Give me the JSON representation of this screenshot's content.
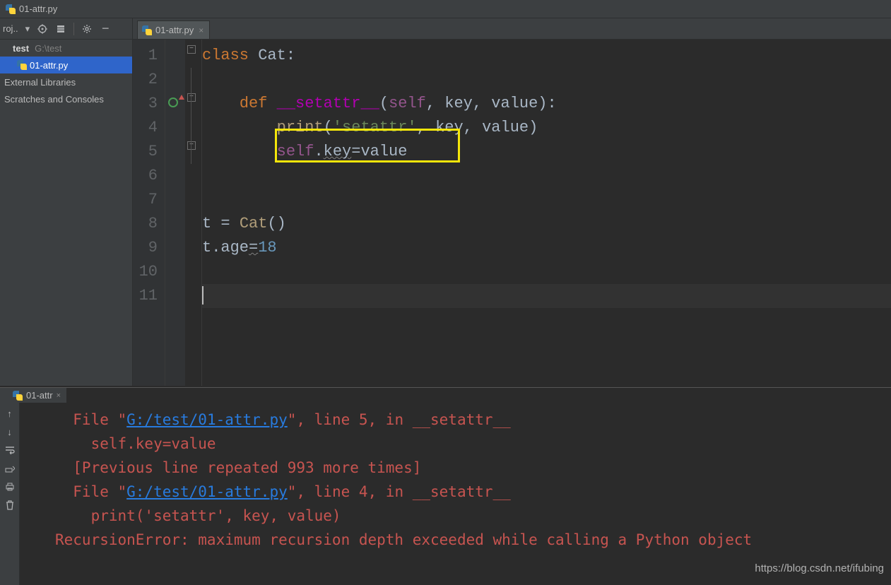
{
  "titlebar": {
    "filename": "01-attr.py"
  },
  "toolbar": {
    "project_label": "roj..",
    "icons": [
      "target",
      "stack",
      "gear",
      "minus"
    ]
  },
  "editor_tab": {
    "label": "01-attr.py"
  },
  "sidebar": {
    "root_name": "test",
    "root_path": "G:\\test",
    "file": "01-attr.py",
    "ext_libs": "External Libraries",
    "scratches": "Scratches and Consoles"
  },
  "gutter": [
    "1",
    "2",
    "3",
    "4",
    "5",
    "6",
    "7",
    "8",
    "9",
    "10",
    "11"
  ],
  "code": {
    "l1": {
      "kw": "class",
      "name": "Cat",
      "colon": ":"
    },
    "l3": {
      "kw": "def",
      "magic": "__setattr__",
      "args_open": "(",
      "self": "self",
      "args_rest": ", key, value):"
    },
    "l4": {
      "call": "print",
      "open": "(",
      "str": "'setattr'",
      "rest": ", key, value)"
    },
    "l5": {
      "self": "self",
      "dot": ".",
      "key": "key",
      "eq": "=",
      "val": "value"
    },
    "l8": {
      "t": "t = ",
      "call": "Cat",
      "rest": "()"
    },
    "l9": {
      "lhs": "t.age",
      "eq": "=",
      "num": "18"
    }
  },
  "run_tab": {
    "label": "01-attr"
  },
  "console": {
    "l1a": "  File \"",
    "l1path": "G:/test/01-attr.py",
    "l1b": "\", line 5, in __setattr__",
    "l2": "    self.key=value",
    "l3": "  [Previous line repeated 993 more times]",
    "l4a": "  File \"",
    "l4path": "G:/test/01-attr.py",
    "l4b": "\", line 4, in __setattr__",
    "l5": "    print('setattr', key, value)",
    "l6": "RecursionError: maximum recursion depth exceeded while calling a Python object"
  },
  "watermark": "https://blog.csdn.net/ifubing"
}
